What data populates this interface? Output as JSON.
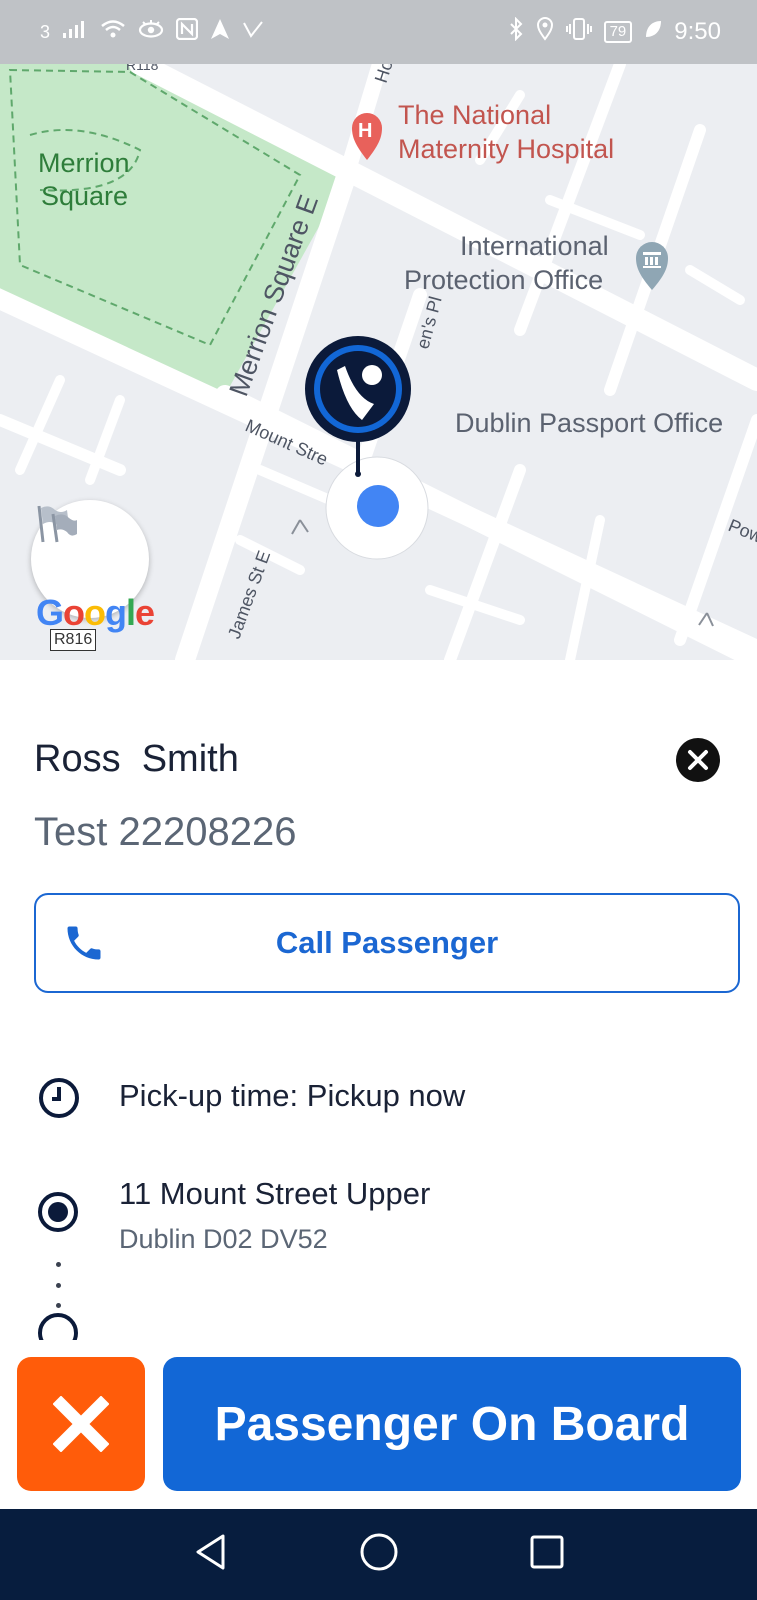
{
  "status_bar": {
    "carrier_indicator": "3",
    "battery_level": "79",
    "time": "9:50",
    "left_icons": [
      "signal-icon",
      "wifi-icon",
      "eye-icon",
      "nfc-icon",
      "navigation-icon",
      "check-icon"
    ],
    "right_icons": [
      "bluetooth-icon",
      "location-icon",
      "vibrate-icon",
      "battery-icon",
      "leaf-icon"
    ]
  },
  "map": {
    "labels": {
      "merrion_square_1": "Merrion",
      "merrion_square_2": "Square",
      "hospital_1": "The National",
      "hospital_2": "Maternity Hospital",
      "intl_1": "International",
      "intl_2": "Protection Office",
      "passport": "Dublin Passport Office",
      "street_merrion": "Merrion Square E",
      "street_mount": "Mount Stre",
      "street_james": "James St E",
      "street_pl": "en's Pl",
      "street_ho": "Ho",
      "street_pow": "Pow",
      "road_top": "R118",
      "road_badge": "R816",
      "google": [
        "G",
        "o",
        "o",
        "g",
        "l",
        "e"
      ]
    }
  },
  "passenger": {
    "name": "Ross  Smith",
    "subtitle": "Test 22208226"
  },
  "call_button": {
    "label": "Call Passenger"
  },
  "pickup": {
    "text": "Pick-up time: Pickup now"
  },
  "address": {
    "line1": "11 Mount Street Upper",
    "line2": "Dublin D02 DV52"
  },
  "actions": {
    "onboard_label": "Passenger On Board"
  },
  "colors": {
    "primary": "#1267d6",
    "cancel": "#ff5c0a",
    "nav_bar": "#071d3e",
    "park": "#c5e8c8"
  }
}
